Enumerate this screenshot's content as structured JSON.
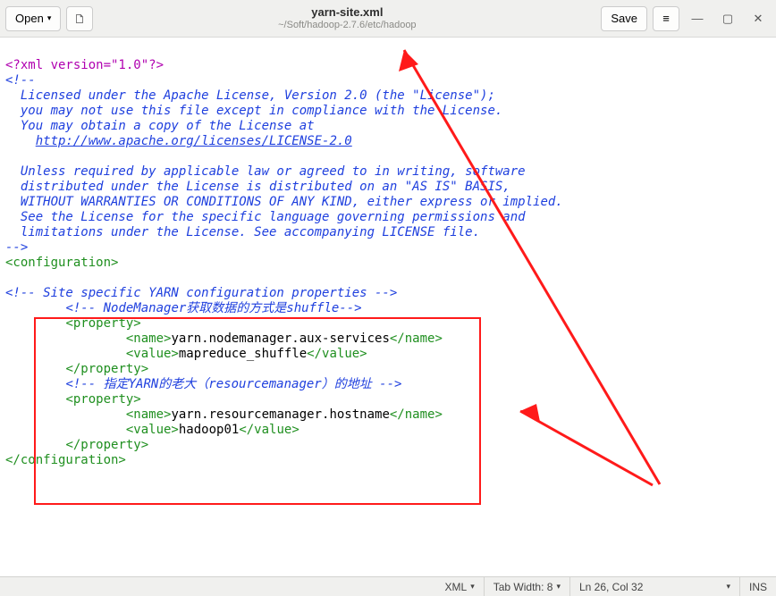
{
  "toolbar": {
    "open_label": "Open",
    "save_label": "Save",
    "title": "yarn-site.xml",
    "path": "~/Soft/hadoop-2.7.6/etc/hadoop"
  },
  "editor": {
    "xml_decl": "<?xml version=\"1.0\"?>",
    "comment_open": "<!--",
    "license_l1": "  Licensed under the Apache License, Version 2.0 (the \"License\");",
    "license_l2": "  you may not use this file except in compliance with the License.",
    "license_l3": "  You may obtain a copy of the License at",
    "license_link": "http://www.apache.org/licenses/LICENSE-2.0",
    "license_l4": "  Unless required by applicable law or agreed to in writing, software",
    "license_l5": "  distributed under the License is distributed on an \"AS IS\" BASIS,",
    "license_l6": "  WITHOUT WARRANTIES OR CONDITIONS OF ANY KIND, either express or implied.",
    "license_l7": "  See the License for the specific language governing permissions and",
    "license_l8": "  limitations under the License. See accompanying LICENSE file.",
    "comment_close": "-->",
    "cfg_open": "<configuration>",
    "site_comment": "<!-- Site specific YARN configuration properties -->",
    "c1_open": "<!--",
    "c1_text": " NodeManager获取数据的方式是shuffle",
    "c1_close": "-->",
    "prop_open": "<property>",
    "name_open": "<name>",
    "name_close": "</name>",
    "value_open": "<value>",
    "value_close": "</value>",
    "prop_close": "</property>",
    "p1_name": "yarn.nodemanager.aux-services",
    "p1_value": "mapreduce_shuffle",
    "c2_open": "<!--",
    "c2_text": " 指定YARN的老大（resourcemanager）的地址 ",
    "c2_close": "-->",
    "p2_name": "yarn.resourcemanager.hostname",
    "p2_value": "hadoop01",
    "cfg_close": "</configuration>"
  },
  "statusbar": {
    "lang": "XML",
    "tab": "Tab Width: 8",
    "pos": "Ln 26, Col 32",
    "ins": "INS"
  }
}
